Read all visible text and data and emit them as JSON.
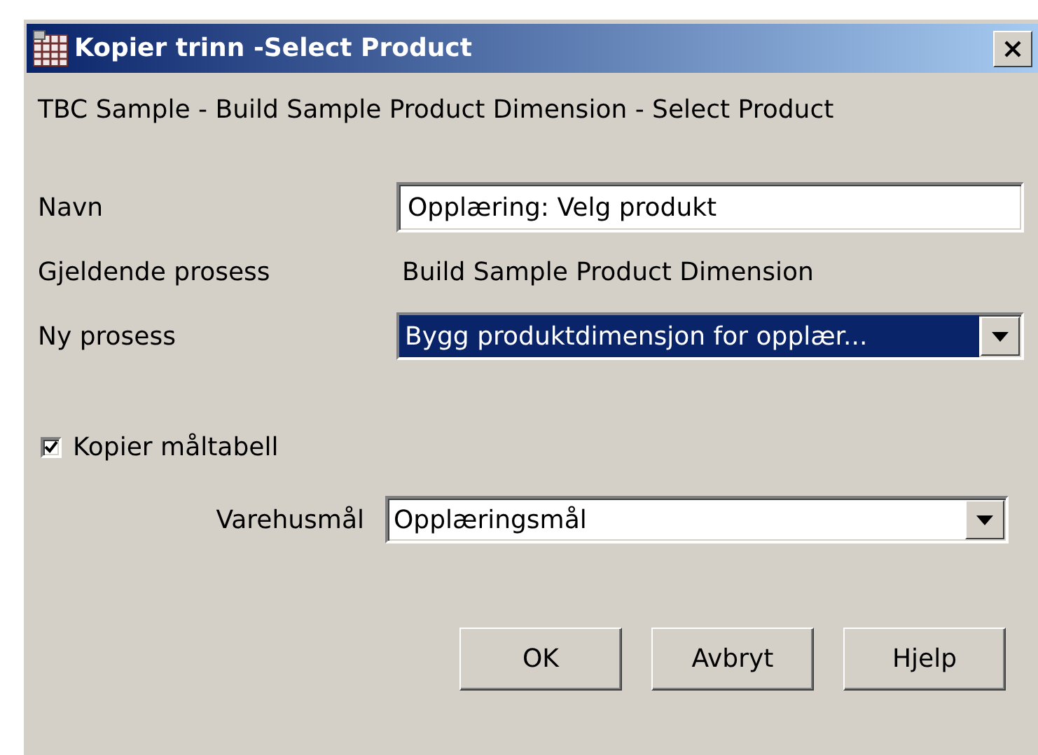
{
  "window": {
    "title": "Kopier trinn -Select Product"
  },
  "subtitle": "TBC Sample - Build Sample Product Dimension - Select Product",
  "name_field": {
    "label": "Navn",
    "value": "Opplæring: Velg produkt"
  },
  "current_process": {
    "label": "Gjeldende prosess",
    "value": "Build Sample Product Dimension"
  },
  "new_process": {
    "label": "Ny prosess",
    "value": "Bygg produktdimensjon for opplær...",
    "focused": true
  },
  "copy_target_table": {
    "label": "Kopier måltabell",
    "checked": true
  },
  "warehouse_target": {
    "label": "Varehusmål",
    "value": "Opplæringsmål",
    "focused": false
  },
  "buttons": [
    {
      "label": "OK"
    },
    {
      "label": "Avbryt"
    },
    {
      "label": "Hjelp"
    }
  ]
}
